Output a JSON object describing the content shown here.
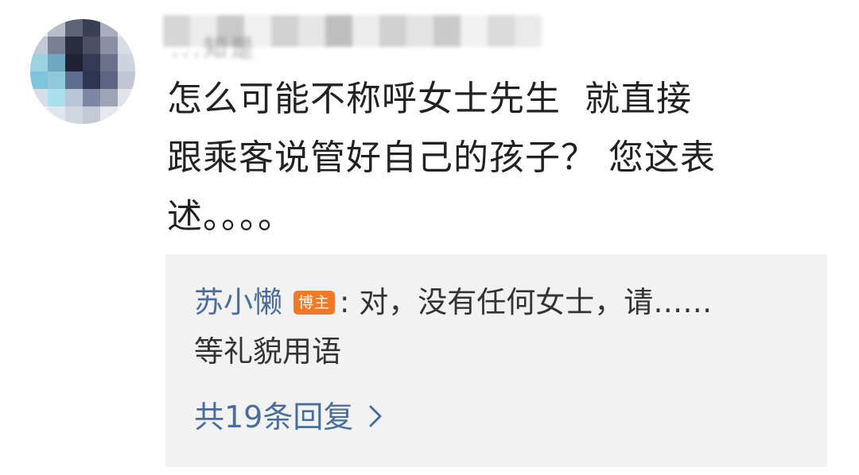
{
  "comment": {
    "avatar_icon": "user-avatar-pixelated",
    "username_visible_fragment": "...知是",
    "text_line1": "怎么可能不称呼女士先生  就直接",
    "text_line2": "跟乘客说管好自己的孩子？ 您这表",
    "text_line3": "述。。。。"
  },
  "reply": {
    "author": "苏小懒",
    "badge": "博主",
    "separator": ":",
    "text_line1": "对，没有任何女士，请……",
    "text_line2": "等礼貌用语",
    "more_label": "共19条回复",
    "more_icon": "chevron-right-icon"
  },
  "colors": {
    "link": "#4a6e9c",
    "badge": "#f07a26",
    "reply_bg": "#f2f2f2",
    "text": "#222222"
  }
}
